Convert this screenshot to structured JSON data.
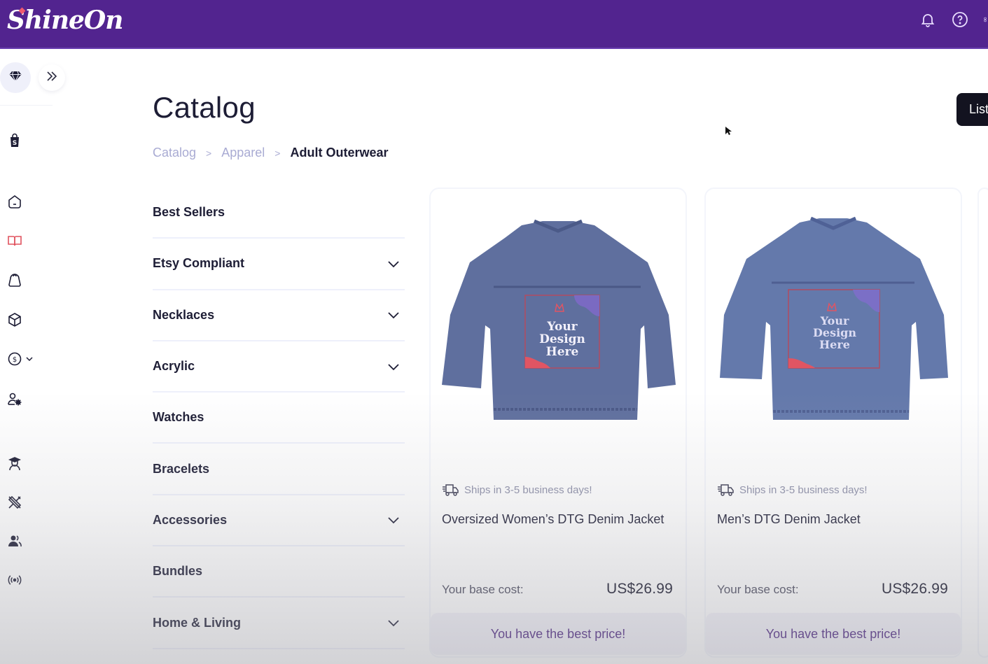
{
  "header": {
    "brand": "ShineOn",
    "icons": [
      "bell-icon",
      "help-icon",
      "user-menu-icon"
    ]
  },
  "sidebar": {
    "brand_icon": "diamond-icon",
    "expand_icon": "double-chevron-right-icon",
    "items": [
      {
        "name": "shopify-icon",
        "active": false
      },
      {
        "name": "home-icon",
        "active": false
      },
      {
        "name": "catalog-book-icon",
        "active": true
      },
      {
        "name": "orders-bag-icon",
        "active": false
      },
      {
        "name": "products-box-icon",
        "active": false
      },
      {
        "name": "billing-dollar-icon",
        "active": false,
        "has_dropdown": true
      },
      {
        "name": "account-settings-icon",
        "active": false
      },
      {
        "name": "academy-icon",
        "active": false
      },
      {
        "name": "design-tools-icon",
        "active": false
      },
      {
        "name": "community-icon",
        "active": false
      },
      {
        "name": "broadcast-icon",
        "active": false
      }
    ],
    "active_color": "#e0535f"
  },
  "page": {
    "title": "Catalog",
    "breadcrumb": [
      {
        "label": "Catalog",
        "link": true
      },
      {
        "label": "Apparel",
        "link": true
      },
      {
        "label": "Adult Outerwear",
        "link": false
      }
    ],
    "list_button_label": "List"
  },
  "categories": [
    {
      "label": "Best Sellers",
      "expandable": false
    },
    {
      "label": "Etsy Compliant",
      "expandable": true
    },
    {
      "label": "Necklaces",
      "expandable": true
    },
    {
      "label": "Acrylic",
      "expandable": true
    },
    {
      "label": "Watches",
      "expandable": false
    },
    {
      "label": "Bracelets",
      "expandable": false
    },
    {
      "label": "Accessories",
      "expandable": true
    },
    {
      "label": "Bundles",
      "expandable": false
    },
    {
      "label": "Home & Living",
      "expandable": true
    }
  ],
  "products": [
    {
      "name": "Oversized Women’s DTG Denim Jacket",
      "shipping": "Ships in 3-5 business days!",
      "cost_label": "Your base cost:",
      "cost": "US$26.99",
      "badge": "You have the best price!",
      "image_text": [
        "Your",
        "Design",
        "Here"
      ]
    },
    {
      "name": "Men’s DTG Denim Jacket",
      "shipping": "Ships in 3-5 business days!",
      "cost_label": "Your base cost:",
      "cost": "US$26.99",
      "badge": "You have the best price!",
      "image_text": [
        "Your",
        "Design",
        "Here"
      ]
    }
  ],
  "colors": {
    "brand_purple": "#52248f",
    "badge_text": "#4b2381",
    "breadcrumb_link": "#a9abd3",
    "heading": "#1d1d35"
  }
}
